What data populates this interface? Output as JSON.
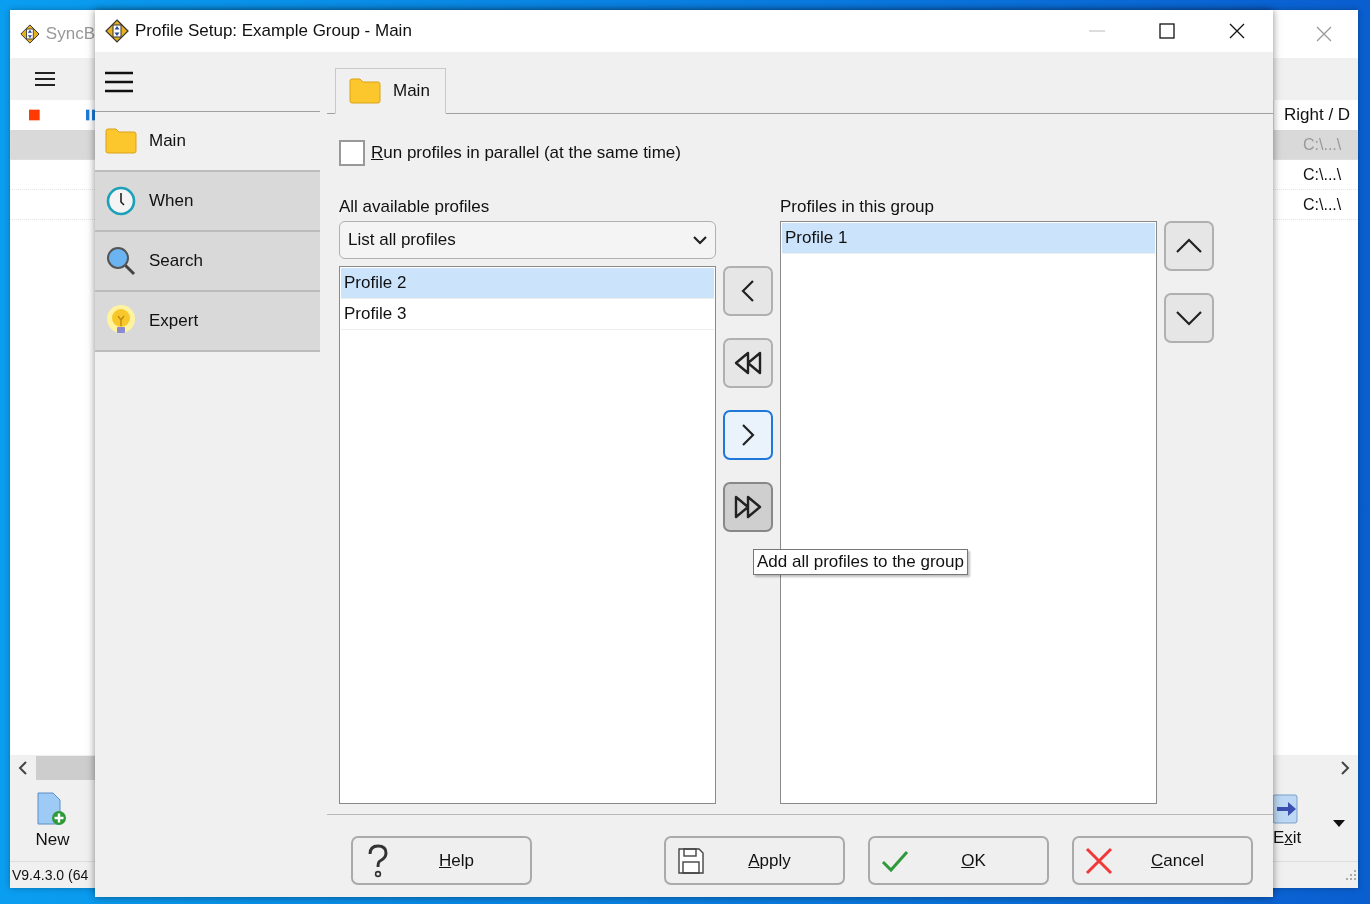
{
  "background_window": {
    "title": "SyncB",
    "column": "Right / D",
    "rows": [
      {
        "right": "C:\\...\\",
        "selected": true
      },
      {
        "right": "C:\\...\\",
        "selected": false
      },
      {
        "right": "C:\\...\\",
        "selected": false
      }
    ],
    "toolbar": [
      {
        "label": "New"
      },
      {
        "label": "Exit"
      }
    ],
    "status": "V9.4.3.0 (64"
  },
  "dialog": {
    "title": "Profile Setup: Example Group - Main",
    "sidebar": [
      {
        "label": "Main",
        "selected": true
      },
      {
        "label": "When",
        "selected": false
      },
      {
        "label": "Search",
        "selected": false
      },
      {
        "label": "Expert",
        "selected": false
      }
    ],
    "tabs": [
      {
        "label": "Main",
        "selected": true
      }
    ],
    "parallel": {
      "label": "Run profiles in parallel (at the same time)",
      "checked": false
    },
    "available": {
      "label": "All available profiles",
      "filter": "List all profiles",
      "items": [
        {
          "label": "Profile 2",
          "selected": true
        },
        {
          "label": "Profile 3",
          "selected": false
        }
      ]
    },
    "group": {
      "label": "Profiles in this group",
      "items": [
        {
          "label": "Profile 1",
          "selected": true
        }
      ]
    },
    "move_buttons": [
      {
        "focused": false,
        "hovered": false
      },
      {
        "focused": false,
        "hovered": false
      },
      {
        "focused": true,
        "hovered": false
      },
      {
        "focused": false,
        "hovered": true
      }
    ],
    "tooltip": "Add all profiles to the group",
    "buttons": [
      {
        "label": "Help"
      },
      {
        "label": "Apply"
      },
      {
        "label": "OK"
      },
      {
        "label": "Cancel"
      }
    ]
  }
}
